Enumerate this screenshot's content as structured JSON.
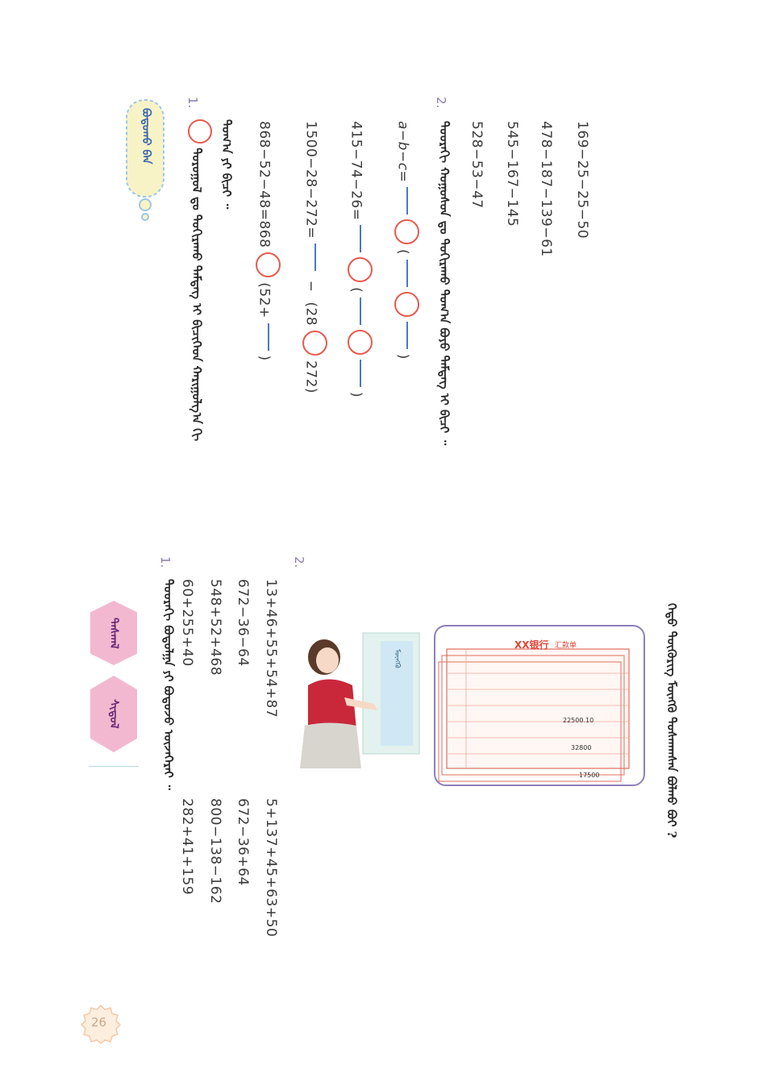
{
  "page_number": "26",
  "tags": {
    "top": "ᠳᠠᠰᠬᠠᠯ",
    "bottom": "ᠰᠢᠳᠤᠯ"
  },
  "top_question": "ᠬᠡᠳᠦ ᠲᠥᠭᠦᠷᠢᠭ ᠮᠥᠩᠭᠦ ᠳᠤᠰᠬᠠᠭᠰᠠᠨ ᠪᠣᠯᠬᠤ ᠪᠤᠢ ?",
  "illustration": {
    "bank_title": "XX银行",
    "bank_subtitle": "汇款单",
    "amounts": [
      "22500.10",
      "32800",
      "17500"
    ],
    "sign_text": "ᠮᠥᠩᠭᠦ"
  },
  "exercise_2_label": "2.",
  "exercise_2_left": [
    "13+46+55+54+87",
    "672−36−64",
    "548+52+468",
    "60+255+40"
  ],
  "exercise_2_right": [
    "5+137+45+63+50",
    "672−36+64",
    "800−138−162",
    "282+41+159"
  ],
  "exercise_1_label": "1.",
  "exercise_1_text": "ᠳᠣᠣᠷᠠᠬᠢ ᠪᠣᠳᠤᠯᠭᠠ ᠶᠢ ᠪᠣᠳᠤᠵᠤ ᠦᠵᠡᠭᠡᠷᠡᠢ ᠃",
  "top_list": [
    "169−25−25−50",
    "478−187−139−61",
    "545−167−145",
    "528−53−47"
  ],
  "q2_label": "2.",
  "q2_text": "ᠳᠣᠣᠷᠠᠬᠢ ᠬᠣᠭᠣᠰᠣᠨ ᠳᠤ ᠲᠣᠬᠢᠷᠠᠬᠤ ᠲᠣᠭ᠎ᠠ ᠪᠤᠶᠤ ᠲᠡᠮᠳᠡᠭ ᠢ ᠪᠢᠴᠢ ᠃",
  "q2_lines": {
    "l1_prefix": "a−b−c=",
    "l1_open": "(",
    "l1_close": ")",
    "l2_prefix": "415−74−26=",
    "l2_open": "(",
    "l2_close": ")",
    "l3_prefix": "1500−28−272=",
    "l3_minus": "−",
    "l3_open": "(28",
    "l3_close": "272)",
    "l4_prefix": "868−52−48=868",
    "l4_open": "(52+",
    "l4_close": ")"
  },
  "thinking_bubble": "ᠪᠣᠳᠤᠬᠤ ᠪᠠᠨ",
  "q1_label": "1.",
  "q1_text": "ᠳᠣᠷᠣᠭᠣᠯ ᠳᠤ ᠲᠣᠬᠢᠷᠠᠬᠤ ᠲᠡᠮᠳᠡᠭ ᠢ ᠪᠢᠴᠢᠭᠡᠳ ᠬᠠᠷᠢᠭᠤᠯᠭ᠎ᠠ ᠬᠢ",
  "q1_text2": "ᠲᠣᠭ᠎ᠠ ᠶᠢ ᠪᠢᠴᠢ ᠃"
}
